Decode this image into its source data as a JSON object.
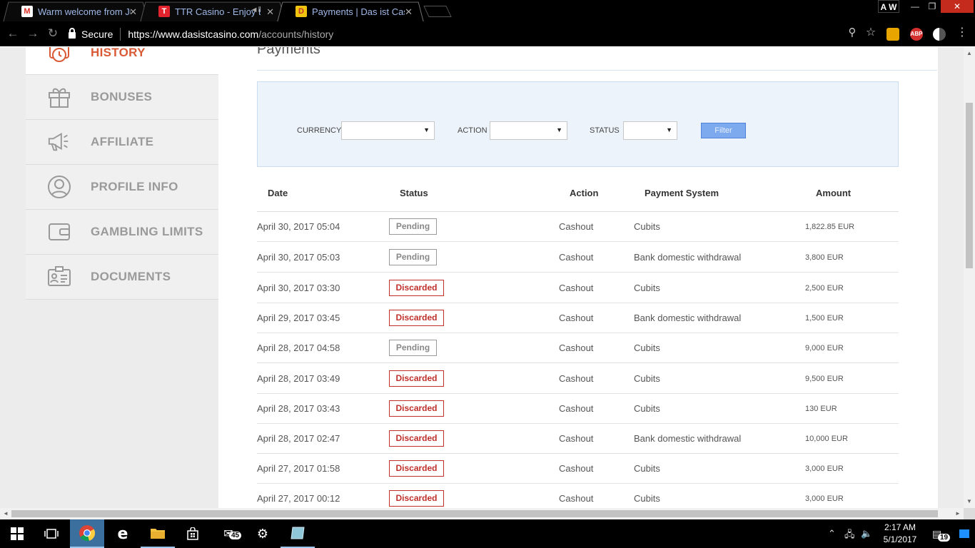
{
  "browser": {
    "tabs": [
      {
        "title": "Warm welcome from Juli",
        "favicon": "gmail-icon",
        "favicon_color": "#ffffff",
        "favicon_letter": "M",
        "favicon_letter_color": "#d93025"
      },
      {
        "title": "TTR Casino - Enjoy th",
        "favicon": "ttr-icon",
        "favicon_color": "#e0232d",
        "favicon_letter": "T",
        "favicon_letter_color": "#ffffff"
      },
      {
        "title": "Payments | Das ist Casino",
        "favicon": "dasist-icon",
        "favicon_color": "#f1c40f",
        "favicon_letter": "D",
        "favicon_letter_color": "#c0392b"
      }
    ],
    "profile_initials": "A W",
    "secure_label": "Secure",
    "url_host": "https://www.dasistcasino.com",
    "url_path": "/accounts/history",
    "extensions": {
      "abp_label": "ABP"
    }
  },
  "sidebar": {
    "items": [
      {
        "label": "HISTORY",
        "icon": "history-clock-icon",
        "active": true
      },
      {
        "label": "BONUSES",
        "icon": "gift-icon",
        "active": false
      },
      {
        "label": "AFFILIATE",
        "icon": "megaphone-icon",
        "active": false
      },
      {
        "label": "PROFILE INFO",
        "icon": "user-profile-icon",
        "active": false
      },
      {
        "label": "GAMBLING LIMITS",
        "icon": "wallet-icon",
        "active": false
      },
      {
        "label": "DOCUMENTS",
        "icon": "id-card-icon",
        "active": false
      }
    ]
  },
  "main": {
    "title": "Payments",
    "filter": {
      "currency_label": "CURRENCY",
      "currency_value": "",
      "action_label": "ACTION",
      "action_value": "",
      "status_label": "STATUS",
      "status_value": "",
      "filter_button": "Filter"
    },
    "table": {
      "headers": [
        "Date",
        "Status",
        "Action",
        "Payment System",
        "Amount"
      ],
      "rows": [
        {
          "date": "April 30, 2017 05:04",
          "status": "Pending",
          "action": "Cashout",
          "system": "Cubits",
          "amount": "1,822.85 EUR"
        },
        {
          "date": "April 30, 2017 05:03",
          "status": "Pending",
          "action": "Cashout",
          "system": "Bank domestic withdrawal",
          "amount": "3,800 EUR"
        },
        {
          "date": "April 30, 2017 03:30",
          "status": "Discarded",
          "action": "Cashout",
          "system": "Cubits",
          "amount": "2,500 EUR"
        },
        {
          "date": "April 29, 2017 03:45",
          "status": "Discarded",
          "action": "Cashout",
          "system": "Bank domestic withdrawal",
          "amount": "1,500 EUR"
        },
        {
          "date": "April 28, 2017 04:58",
          "status": "Pending",
          "action": "Cashout",
          "system": "Cubits",
          "amount": "9,000 EUR"
        },
        {
          "date": "April 28, 2017 03:49",
          "status": "Discarded",
          "action": "Cashout",
          "system": "Cubits",
          "amount": "9,500 EUR"
        },
        {
          "date": "April 28, 2017 03:43",
          "status": "Discarded",
          "action": "Cashout",
          "system": "Cubits",
          "amount": "130 EUR"
        },
        {
          "date": "April 28, 2017 02:47",
          "status": "Discarded",
          "action": "Cashout",
          "system": "Bank domestic withdrawal",
          "amount": "10,000 EUR"
        },
        {
          "date": "April 27, 2017 01:58",
          "status": "Discarded",
          "action": "Cashout",
          "system": "Cubits",
          "amount": "3,000 EUR"
        },
        {
          "date": "April 27, 2017 00:12",
          "status": "Discarded",
          "action": "Cashout",
          "system": "Cubits",
          "amount": "3,000 EUR"
        }
      ]
    }
  },
  "taskbar": {
    "mail_count": "45",
    "notification_count": "19",
    "time": "2:17 AM",
    "date": "5/1/2017"
  },
  "colors": {
    "accent": "#d95a35",
    "discarded": "#c0302a",
    "filter_button": "#7da9ee"
  }
}
